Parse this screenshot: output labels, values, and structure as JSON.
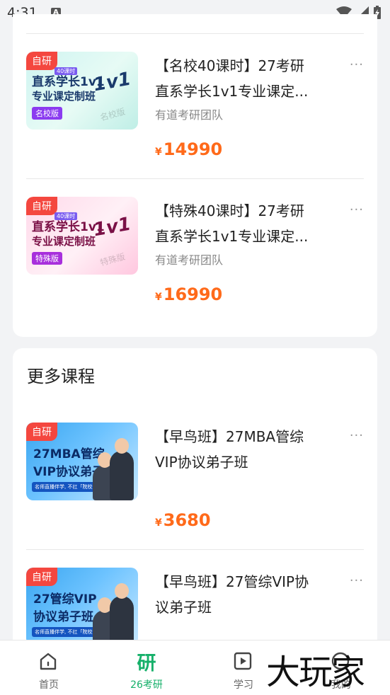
{
  "status_bar": {
    "time": "4:31",
    "notif_icon": "A"
  },
  "courses_top": [
    {
      "tag": "自研",
      "thumb": {
        "corner": "40课时",
        "line1": "直系学长1v1",
        "line2": "专业课定制班",
        "badge": "名校版",
        "big": "1v1",
        "ver": "名校版",
        "theme": "green"
      },
      "title_line1": "【名校40课时】27考研",
      "title_line2": "直系学长1v1专业课定...",
      "author": "有道考研团队",
      "currency": "¥",
      "price": "14990"
    },
    {
      "tag": "自研",
      "thumb": {
        "corner": "40课时",
        "line1": "直系学长1v1",
        "line2": "专业课定制班",
        "badge": "特殊版",
        "big": "1v1",
        "ver": "特殊版",
        "theme": "pink"
      },
      "title_line1": "【特殊40课时】27考研",
      "title_line2": "直系学长1v1专业课定...",
      "author": "有道考研团队",
      "currency": "¥",
      "price": "16990"
    }
  ],
  "more_section": {
    "title": "更多课程",
    "courses": [
      {
        "tag": "自研",
        "thumb": {
          "line1": "27MBA管综",
          "line2": "VIP协议弟子班",
          "strip": "名师直播伴学, 不扛「院校选」套读"
        },
        "title_line1": "【早鸟班】27MBA管综",
        "title_line2": "VIP协议弟子班",
        "currency": "¥",
        "price": "3680"
      },
      {
        "tag": "自研",
        "thumb": {
          "line1": "27管综VIP",
          "line2": "协议弟子班",
          "strip": "名师直播伴学, 不扛「院校选」套读"
        },
        "title_line1": "【早鸟班】27管综VIP协",
        "title_line2": "议弟子班"
      }
    ]
  },
  "tabbar": {
    "tabs": [
      {
        "label": "首页",
        "icon": "home-icon"
      },
      {
        "label": "26考研",
        "icon_text": "研",
        "active": true
      },
      {
        "label": "学习",
        "icon": "play-icon"
      },
      {
        "label": "我的",
        "icon": "user-icon"
      }
    ]
  },
  "more_glyph": "···",
  "watermark": "大玩家",
  "colors": {
    "accent_green": "#16b06a",
    "price_orange": "#ff6a1a",
    "tag_red": "#f4473f"
  }
}
